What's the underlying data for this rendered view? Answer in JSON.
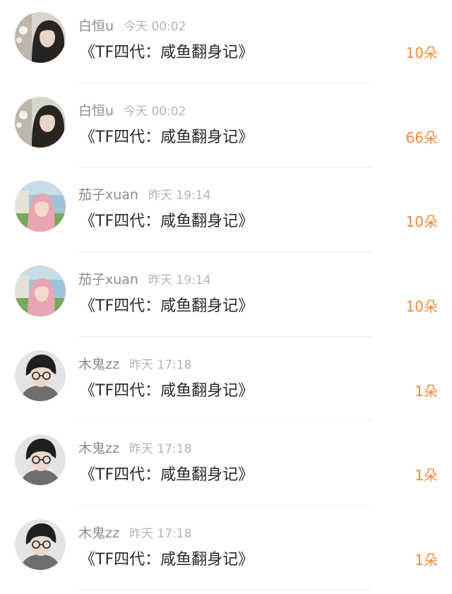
{
  "gifts": [
    {
      "user": "白恒u",
      "time": "今天 00:02",
      "title": "《TF四代：咸鱼翻身记》",
      "count": "10朵",
      "avatar_icon": "user-avatar-icon-female-dark-hair"
    },
    {
      "user": "白恒u",
      "time": "今天 00:02",
      "title": "《TF四代：咸鱼翻身记》",
      "count": "66朵",
      "avatar_icon": "user-avatar-icon-female-dark-hair"
    },
    {
      "user": "茄子xuan",
      "time": "昨天 19:14",
      "title": "《TF四代：咸鱼翻身记》",
      "count": "10朵",
      "avatar_icon": "user-avatar-icon-female-pink-hair"
    },
    {
      "user": "茄子xuan",
      "time": "昨天 19:14",
      "title": "《TF四代：咸鱼翻身记》",
      "count": "10朵",
      "avatar_icon": "user-avatar-icon-female-pink-hair"
    },
    {
      "user": "木鬼zz",
      "time": "昨天 17:18",
      "title": "《TF四代：咸鱼翻身记》",
      "count": "1朵",
      "avatar_icon": "user-avatar-icon-male-glasses"
    },
    {
      "user": "木鬼zz",
      "time": "昨天 17:18",
      "title": "《TF四代：咸鱼翻身记》",
      "count": "1朵",
      "avatar_icon": "user-avatar-icon-male-glasses"
    },
    {
      "user": "木鬼zz",
      "time": "昨天 17:18",
      "title": "《TF四代：咸鱼翻身记》",
      "count": "1朵",
      "avatar_icon": "user-avatar-icon-male-glasses"
    }
  ],
  "colors": {
    "count": "#f18a3a",
    "username": "#8c8c8c",
    "time": "#b4b4b4",
    "title": "#2a2a2a",
    "divider": "#ececec"
  }
}
